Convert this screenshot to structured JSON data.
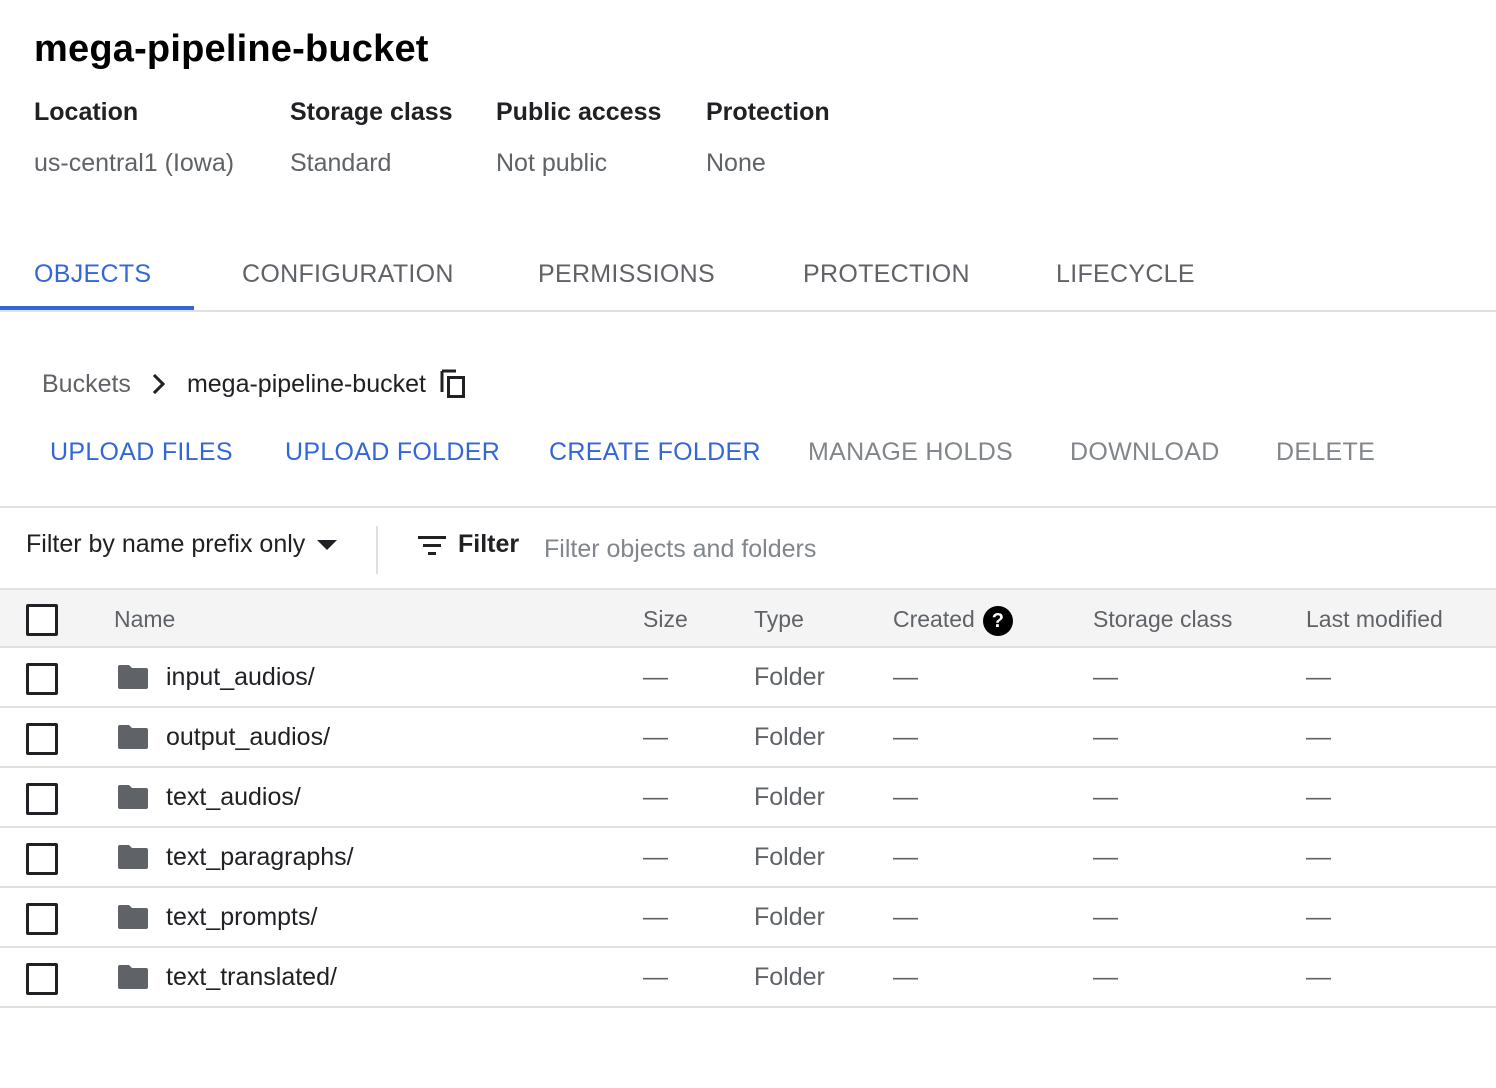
{
  "bucket": {
    "title": "mega-pipeline-bucket",
    "properties": [
      {
        "label": "Location",
        "value": "us-central1 (Iowa)"
      },
      {
        "label": "Storage class",
        "value": "Standard"
      },
      {
        "label": "Public access",
        "value": "Not public"
      },
      {
        "label": "Protection",
        "value": "None"
      }
    ]
  },
  "tabs": [
    {
      "label": "OBJECTS",
      "active": true
    },
    {
      "label": "CONFIGURATION"
    },
    {
      "label": "PERMISSIONS"
    },
    {
      "label": "PROTECTION"
    },
    {
      "label": "LIFECYCLE"
    }
  ],
  "breadcrumb": {
    "root": "Buckets",
    "current": "mega-pipeline-bucket",
    "icons": {
      "separator": "chevron-right-icon",
      "copy": "copy-icon"
    }
  },
  "actions": [
    {
      "label": "UPLOAD FILES",
      "enabled": true
    },
    {
      "label": "UPLOAD FOLDER",
      "enabled": true
    },
    {
      "label": "CREATE FOLDER",
      "enabled": true
    },
    {
      "label": "MANAGE HOLDS",
      "enabled": false
    },
    {
      "label": "DOWNLOAD",
      "enabled": false
    },
    {
      "label": "DELETE",
      "enabled": false
    }
  ],
  "filter": {
    "prefix_mode": "Filter by name prefix only",
    "button_label": "Filter",
    "placeholder": "Filter objects and folders",
    "value": ""
  },
  "table": {
    "columns": [
      "Name",
      "Size",
      "Type",
      "Created",
      "Storage class",
      "Last modified"
    ],
    "rows": [
      {
        "name": "input_audios/",
        "size": "—",
        "type": "Folder",
        "created": "—",
        "storage_class": "—",
        "last_modified": "—"
      },
      {
        "name": "output_audios/",
        "size": "—",
        "type": "Folder",
        "created": "—",
        "storage_class": "—",
        "last_modified": "—"
      },
      {
        "name": "text_audios/",
        "size": "—",
        "type": "Folder",
        "created": "—",
        "storage_class": "—",
        "last_modified": "—"
      },
      {
        "name": "text_paragraphs/",
        "size": "—",
        "type": "Folder",
        "created": "—",
        "storage_class": "—",
        "last_modified": "—"
      },
      {
        "name": "text_prompts/",
        "size": "—",
        "type": "Folder",
        "created": "—",
        "storage_class": "—",
        "last_modified": "—"
      },
      {
        "name": "text_translated/",
        "size": "—",
        "type": "Folder",
        "created": "—",
        "storage_class": "—",
        "last_modified": "—"
      }
    ]
  },
  "colors": {
    "accent": "#3367d6",
    "text": "#202124",
    "muted": "#5f6368",
    "disabled": "#80868b",
    "border": "#e0e0e0",
    "header_bg": "#f4f4f4"
  }
}
